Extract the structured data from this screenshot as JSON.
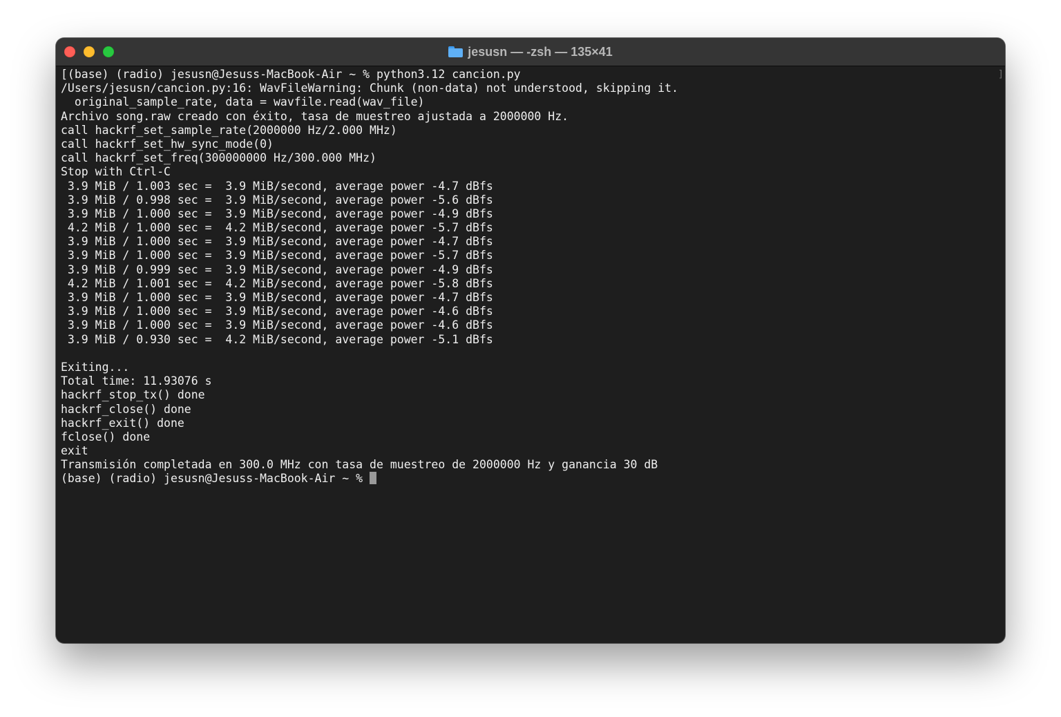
{
  "window": {
    "title": "jesusn — -zsh — 135×41",
    "folder_icon": "folder-icon"
  },
  "terminal": {
    "lines": [
      "[(base) (radio) jesusn@Jesuss-MacBook-Air ~ % python3.12 cancion.py",
      "/Users/jesusn/cancion.py:16: WavFileWarning: Chunk (non-data) not understood, skipping it.",
      "  original_sample_rate, data = wavfile.read(wav_file)",
      "Archivo song.raw creado con éxito, tasa de muestreo ajustada a 2000000 Hz.",
      "call hackrf_set_sample_rate(2000000 Hz/2.000 MHz)",
      "call hackrf_set_hw_sync_mode(0)",
      "call hackrf_set_freq(300000000 Hz/300.000 MHz)",
      "Stop with Ctrl-C",
      " 3.9 MiB / 1.003 sec =  3.9 MiB/second, average power -4.7 dBfs",
      " 3.9 MiB / 0.998 sec =  3.9 MiB/second, average power -5.6 dBfs",
      " 3.9 MiB / 1.000 sec =  3.9 MiB/second, average power -4.9 dBfs",
      " 4.2 MiB / 1.000 sec =  4.2 MiB/second, average power -5.7 dBfs",
      " 3.9 MiB / 1.000 sec =  3.9 MiB/second, average power -4.7 dBfs",
      " 3.9 MiB / 1.000 sec =  3.9 MiB/second, average power -5.7 dBfs",
      " 3.9 MiB / 0.999 sec =  3.9 MiB/second, average power -4.9 dBfs",
      " 4.2 MiB / 1.001 sec =  4.2 MiB/second, average power -5.8 dBfs",
      " 3.9 MiB / 1.000 sec =  3.9 MiB/second, average power -4.7 dBfs",
      " 3.9 MiB / 1.000 sec =  3.9 MiB/second, average power -4.6 dBfs",
      " 3.9 MiB / 1.000 sec =  3.9 MiB/second, average power -4.6 dBfs",
      " 3.9 MiB / 0.930 sec =  4.2 MiB/second, average power -5.1 dBfs",
      "",
      "Exiting...",
      "Total time: 11.93076 s",
      "hackrf_stop_tx() done",
      "hackrf_close() done",
      "hackrf_exit() done",
      "fclose() done",
      "exit",
      "Transmisión completada en 300.0 MHz con tasa de muestreo de 2000000 Hz y ganancia 30 dB"
    ],
    "prompt": "(base) (radio) jesusn@Jesuss-MacBook-Air ~ % ",
    "scroll_marker": "]"
  }
}
